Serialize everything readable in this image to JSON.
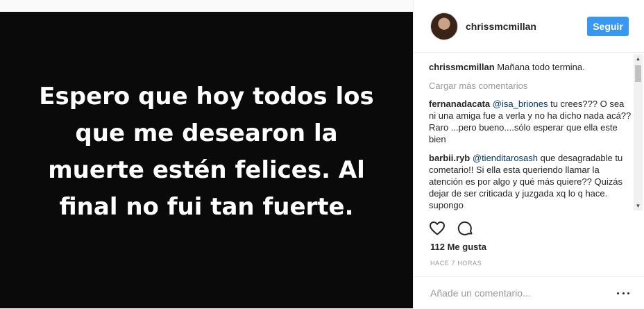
{
  "post": {
    "image_text": "Espero que hoy todos los que me desearon la muerte estén felices. Al final no fui tan fuerte."
  },
  "header": {
    "username": "chrissmcmillan",
    "follow_label": "Seguir"
  },
  "caption": {
    "username": "chrissmcmillan",
    "text": "Mañana todo termina."
  },
  "load_more_label": "Cargar más comentarios",
  "comments": [
    {
      "username": "fernanadacata",
      "mention": "@isa_briones",
      "text": "tu crees??? O sea ni una amiga fue a verla y no ha dicho nada acá?? Raro ...pero bueno....sólo esperar que ella este bien"
    },
    {
      "username": "barbii.ryb",
      "mention": "@tienditarosash",
      "text": "que desagradable tu cometario!! Si ella esta queriendo llamar la atención es por algo y qué más quiere?? Quizás dejar de ser criticada y juzgada xq lo q hace. supongo"
    }
  ],
  "likes_label": "112 Me gusta",
  "time_label": "HACE 7 HORAS",
  "add_comment_placeholder": "Añade un comentario...",
  "colors": {
    "accent": "#3897f0",
    "mention": "#003569",
    "muted": "#999999",
    "media_background": "#0a0a0a"
  },
  "icons": [
    "heart-icon",
    "comment-icon",
    "more-options-icon"
  ]
}
